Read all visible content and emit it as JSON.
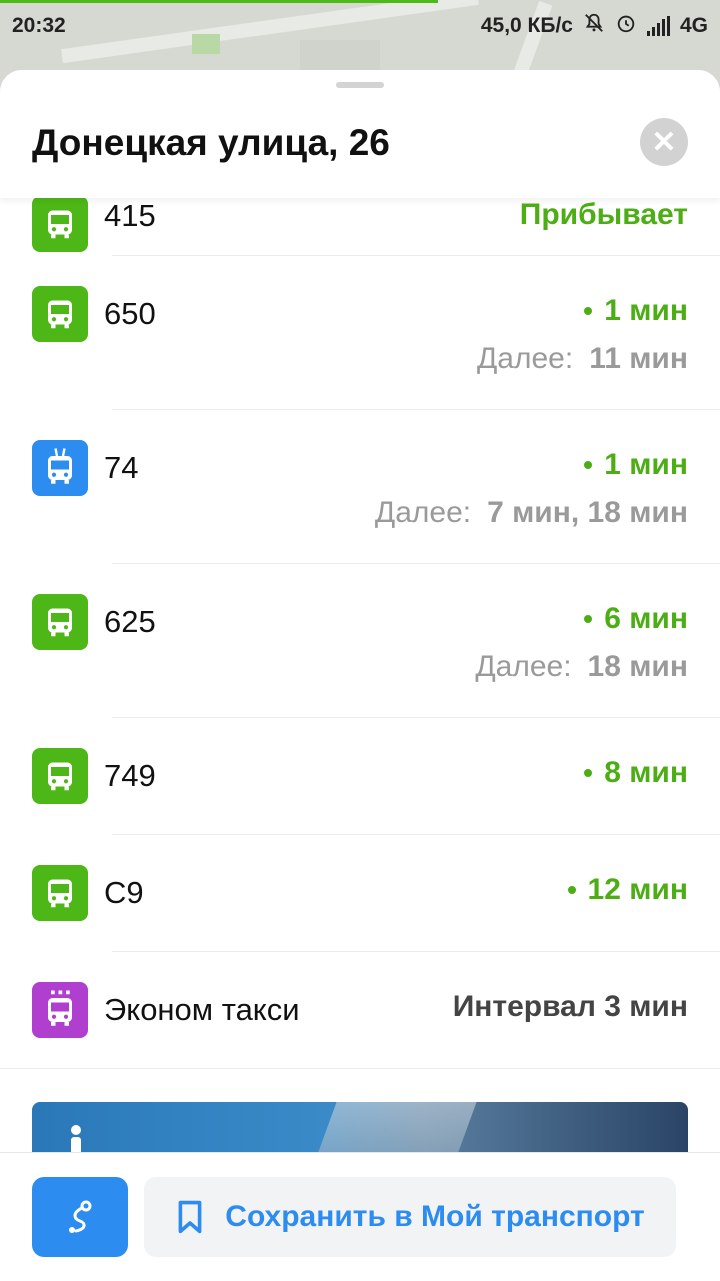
{
  "status_bar": {
    "time": "20:32",
    "network_speed": "45,0 КБ/с",
    "network_type": "4G",
    "icons": [
      "mute-notifications-icon",
      "alarm-icon",
      "signal-icon"
    ]
  },
  "sheet": {
    "title": "Донецкая улица, 26",
    "close_icon": "close-icon"
  },
  "routes": [
    {
      "type": "bus",
      "number": "415",
      "arrival": "Прибывает",
      "partially_hidden": true,
      "color": "#4cb716"
    },
    {
      "type": "bus",
      "number": "650",
      "arrival": "1 мин",
      "next_label": "Далее:",
      "next": "11 мин",
      "color": "#4cb716"
    },
    {
      "type": "trolleybus",
      "number": "74",
      "arrival": "1 мин",
      "next_label": "Далее:",
      "next": "7 мин, 18 мин",
      "color": "#2d8cf0"
    },
    {
      "type": "bus",
      "number": "625",
      "arrival": "6 мин",
      "next_label": "Далее:",
      "next": "18 мин",
      "color": "#4cb716"
    },
    {
      "type": "bus",
      "number": "749",
      "arrival": "8 мин",
      "color": "#4cb716"
    },
    {
      "type": "bus",
      "number": "С9",
      "arrival": "12 мин",
      "color": "#4cb716"
    },
    {
      "type": "minibus",
      "number": "Эконом такси",
      "interval": "Интервал 3 мин",
      "color": "#b03fcf"
    }
  ],
  "bottom_bar": {
    "route_button_icon": "route-icon",
    "save_label": "Сохранить в Мой транспорт",
    "save_icon": "bookmark-icon"
  },
  "colors": {
    "accent_green": "#4cae14",
    "accent_blue": "#2d8cf0",
    "taxi_purple": "#b03fcf"
  }
}
